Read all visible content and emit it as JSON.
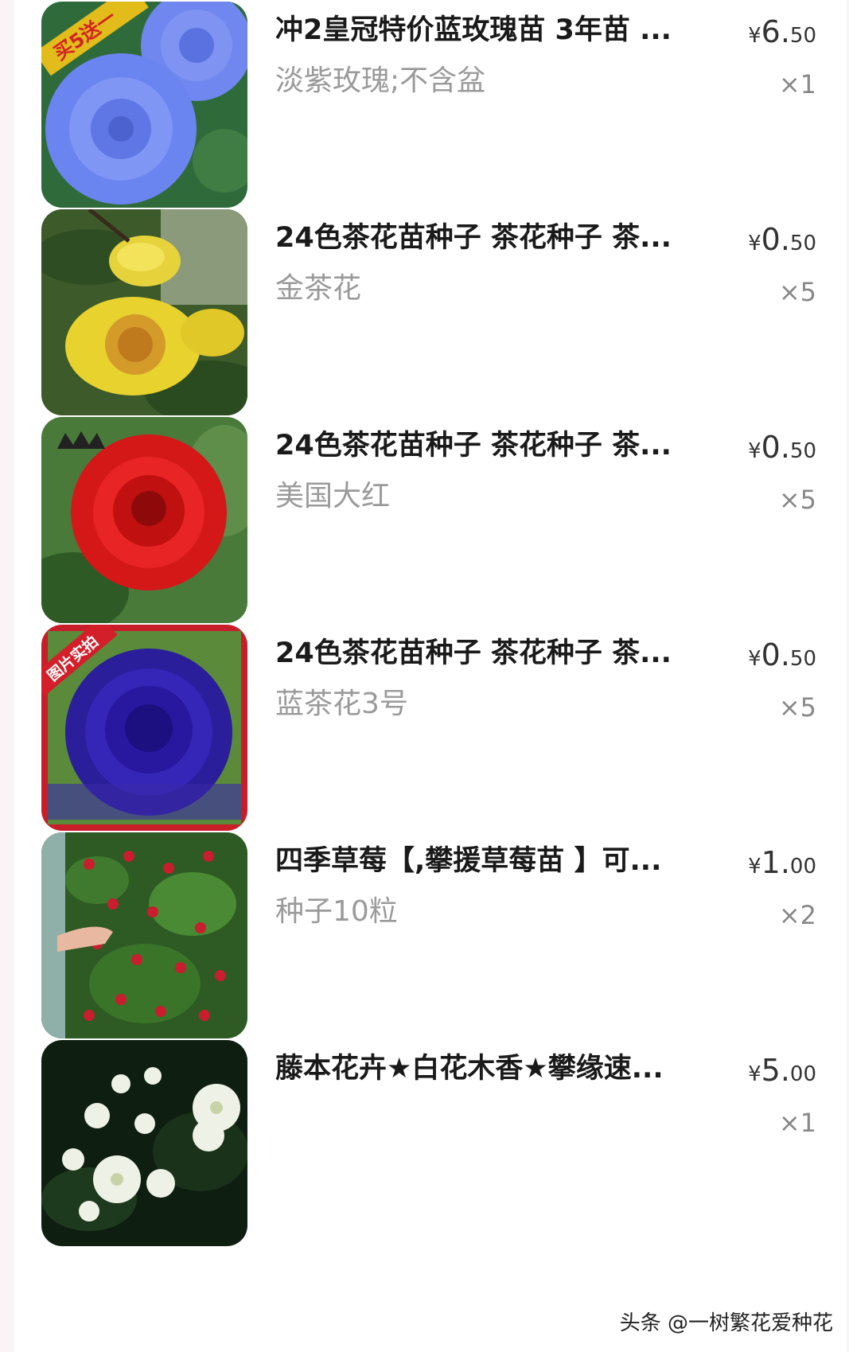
{
  "items": [
    {
      "title": "冲2皇冠特价蓝玫瑰苗 3年苗 ...",
      "spec": "淡紫玫瑰;不含盆",
      "price_currency": "¥",
      "price_int": "6.",
      "price_dec": "50",
      "quantity": "×1",
      "image_badge": "买5送一",
      "image_subject": "blue rose"
    },
    {
      "title": "24色茶花苗种子 茶花种子 茶...",
      "spec": "金茶花",
      "price_currency": "¥",
      "price_int": "0.",
      "price_dec": "50",
      "quantity": "×5",
      "image_subject": "golden camellia"
    },
    {
      "title": "24色茶花苗种子 茶花种子 茶...",
      "spec": "美国大红",
      "price_currency": "¥",
      "price_int": "0.",
      "price_dec": "50",
      "quantity": "×5",
      "image_subject": "red camellia"
    },
    {
      "title": "24色茶花苗种子 茶花种子 茶...",
      "spec": "蓝茶花3号",
      "price_currency": "¥",
      "price_int": "0.",
      "price_dec": "50",
      "quantity": "×5",
      "image_badge": "图片实拍",
      "image_subject": "blue camellia"
    },
    {
      "title": "四季草莓【,攀援草莓苗 】可...",
      "spec": "种子10粒",
      "price_currency": "¥",
      "price_int": "1.",
      "price_dec": "00",
      "quantity": "×2",
      "image_subject": "climbing strawberry"
    },
    {
      "title": "藤本花卉★白花木香★攀缘速...",
      "spec": "",
      "price_currency": "¥",
      "price_int": "5.",
      "price_dec": "00",
      "quantity": "×1",
      "image_subject": "white banksia rose"
    }
  ],
  "watermark": "头条 @一树繁花爱种花",
  "colors": {
    "page_background": "#fbf4f6",
    "card_background": "#ffffff",
    "title_text": "#1a1a1a",
    "spec_text": "#9a9a9a",
    "price_text": "#333333"
  }
}
